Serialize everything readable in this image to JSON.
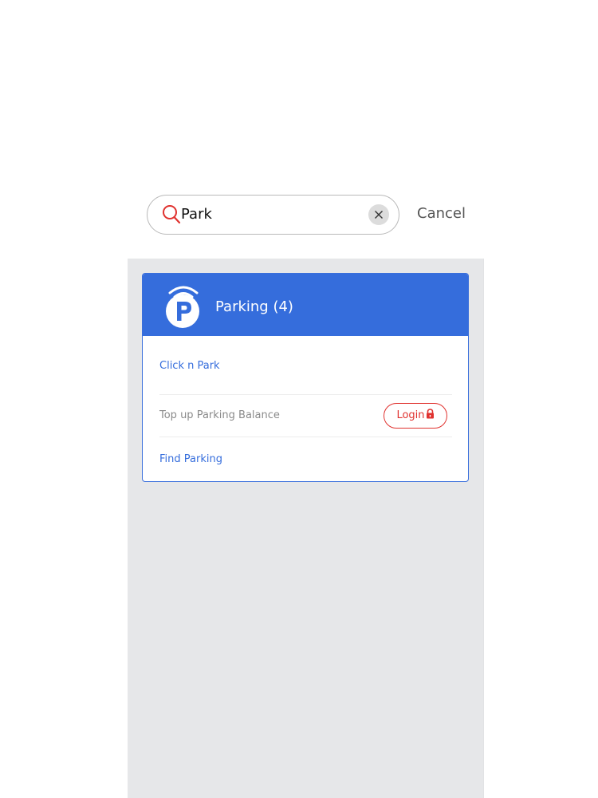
{
  "search": {
    "query": "Park",
    "cancel_label": "Cancel"
  },
  "category": {
    "title": "Parking (4)",
    "icon": "parking-wifi-icon",
    "items": [
      {
        "label": "Click n Park",
        "enabled": true
      },
      {
        "label": "Top up Parking Balance",
        "enabled": false,
        "action_label": "Login"
      },
      {
        "label": "Find Parking",
        "enabled": true
      }
    ]
  },
  "colors": {
    "accent_blue": "#356ddc",
    "login_red": "#e0322f",
    "background_gray": "#e6e7e9"
  }
}
